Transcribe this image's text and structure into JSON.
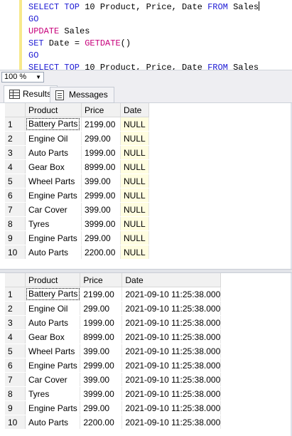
{
  "editor": {
    "lines": [
      [
        {
          "t": "SELECT TOP",
          "c": "kw"
        },
        {
          "t": " 10 Product",
          "c": "id"
        },
        {
          "t": ",",
          "c": "id"
        },
        {
          "t": " Price",
          "c": "id"
        },
        {
          "t": ",",
          "c": "id"
        },
        {
          "t": " Date ",
          "c": "id"
        },
        {
          "t": "FROM",
          "c": "kw"
        },
        {
          "t": " Sales",
          "c": "id"
        }
      ],
      [
        {
          "t": "GO",
          "c": "kw"
        }
      ],
      [
        {
          "t": "UPDATE",
          "c": "fn"
        },
        {
          "t": " Sales",
          "c": "id"
        }
      ],
      [
        {
          "t": "SET",
          "c": "kw"
        },
        {
          "t": " Date ",
          "c": "id"
        },
        {
          "t": "=",
          "c": "id"
        },
        {
          "t": " GETDATE",
          "c": "fn"
        },
        {
          "t": "()",
          "c": "id"
        }
      ],
      [
        {
          "t": "GO",
          "c": "kw"
        }
      ],
      [
        {
          "t": "SELECT TOP",
          "c": "kw"
        },
        {
          "t": " 10 Product",
          "c": "id"
        },
        {
          "t": ",",
          "c": "id"
        },
        {
          "t": " Price",
          "c": "id"
        },
        {
          "t": ",",
          "c": "id"
        },
        {
          "t": " Date ",
          "c": "id"
        },
        {
          "t": "FROM",
          "c": "kw"
        },
        {
          "t": " Sales",
          "c": "id"
        }
      ]
    ]
  },
  "zoom": {
    "value": "100 %"
  },
  "tabs": {
    "results": "Results",
    "messages": "Messages"
  },
  "grid1": {
    "columns": [
      "Product",
      "Price",
      "Date"
    ],
    "rows": [
      [
        "1",
        "Battery Parts",
        "2199.00",
        "NULL"
      ],
      [
        "2",
        "Engine Oil",
        "299.00",
        "NULL"
      ],
      [
        "3",
        "Auto Parts",
        "1999.00",
        "NULL"
      ],
      [
        "4",
        "Gear Box",
        "8999.00",
        "NULL"
      ],
      [
        "5",
        "Wheel Parts",
        "399.00",
        "NULL"
      ],
      [
        "6",
        "Engine Parts",
        "2999.00",
        "NULL"
      ],
      [
        "7",
        "Car Cover",
        "399.00",
        "NULL"
      ],
      [
        "8",
        "Tyres",
        "3999.00",
        "NULL"
      ],
      [
        "9",
        "Engine Parts",
        "299.00",
        "NULL"
      ],
      [
        "10",
        "Auto Parts",
        "2200.00",
        "NULL"
      ]
    ]
  },
  "grid2": {
    "columns": [
      "Product",
      "Price",
      "Date"
    ],
    "rows": [
      [
        "1",
        "Battery Parts",
        "2199.00",
        "2021-09-10 11:25:38.000"
      ],
      [
        "2",
        "Engine Oil",
        "299.00",
        "2021-09-10 11:25:38.000"
      ],
      [
        "3",
        "Auto Parts",
        "1999.00",
        "2021-09-10 11:25:38.000"
      ],
      [
        "4",
        "Gear Box",
        "8999.00",
        "2021-09-10 11:25:38.000"
      ],
      [
        "5",
        "Wheel Parts",
        "399.00",
        "2021-09-10 11:25:38.000"
      ],
      [
        "6",
        "Engine Parts",
        "2999.00",
        "2021-09-10 11:25:38.000"
      ],
      [
        "7",
        "Car Cover",
        "399.00",
        "2021-09-10 11:25:38.000"
      ],
      [
        "8",
        "Tyres",
        "3999.00",
        "2021-09-10 11:25:38.000"
      ],
      [
        "9",
        "Engine Parts",
        "299.00",
        "2021-09-10 11:25:38.000"
      ],
      [
        "10",
        "Auto Parts",
        "2200.00",
        "2021-09-10 11:25:38.000"
      ]
    ]
  }
}
